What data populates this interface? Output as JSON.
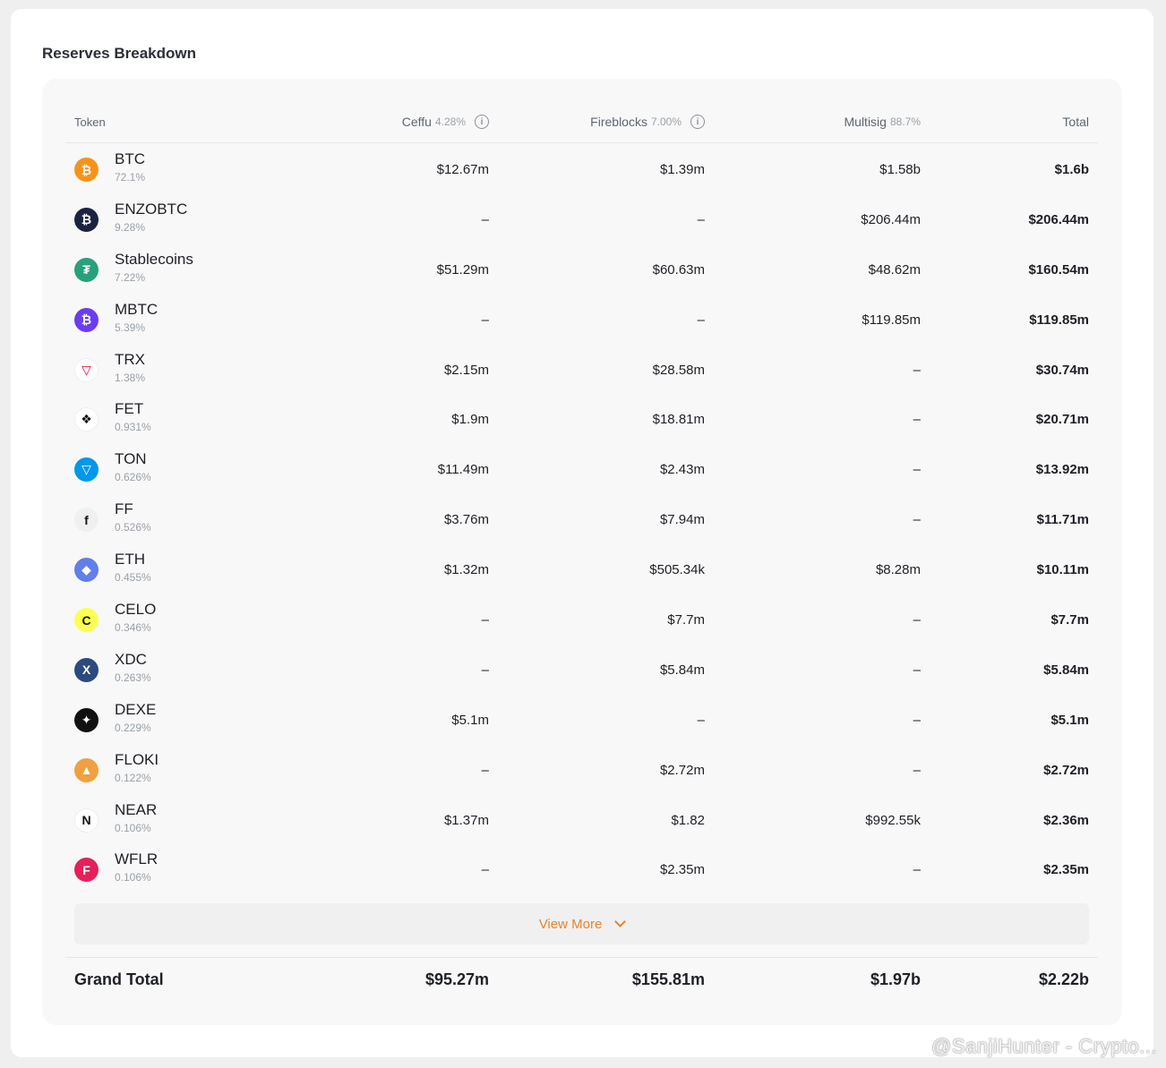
{
  "section_title": "Reserves Breakdown",
  "header": {
    "token": "Token",
    "ceffu": {
      "label": "Ceffu",
      "pct": "4.28%"
    },
    "fireblocks": {
      "label": "Fireblocks",
      "pct": "7.00%"
    },
    "multisig": {
      "label": "Multisig",
      "pct": "88.7%"
    },
    "total": "Total"
  },
  "rows": [
    {
      "name": "BTC",
      "pct": "72.1%",
      "ceffu": "$12.67m",
      "fireblocks": "$1.39m",
      "multisig": "$1.58b",
      "total": "$1.6b",
      "icon": "bitcoin-icon",
      "color": "#f7931a",
      "glyph": "₿"
    },
    {
      "name": "ENZOBTC",
      "pct": "9.28%",
      "ceffu": "–",
      "fireblocks": "–",
      "multisig": "$206.44m",
      "total": "$206.44m",
      "icon": "enzobtc-icon",
      "color": "#1a2340",
      "glyph": "₿"
    },
    {
      "name": "Stablecoins",
      "pct": "7.22%",
      "ceffu": "$51.29m",
      "fireblocks": "$60.63m",
      "multisig": "$48.62m",
      "total": "$160.54m",
      "icon": "tether-icon",
      "color": "#26a17b",
      "glyph": "₮"
    },
    {
      "name": "MBTC",
      "pct": "5.39%",
      "ceffu": "–",
      "fireblocks": "–",
      "multisig": "$119.85m",
      "total": "$119.85m",
      "icon": "mbtc-icon",
      "color": "#6a3df0",
      "glyph": "₿"
    },
    {
      "name": "TRX",
      "pct": "1.38%",
      "ceffu": "$2.15m",
      "fireblocks": "$28.58m",
      "multisig": "–",
      "total": "$30.74m",
      "icon": "tron-icon",
      "color": "#ffffff",
      "glyph": "▽"
    },
    {
      "name": "FET",
      "pct": "0.931%",
      "ceffu": "$1.9m",
      "fireblocks": "$18.81m",
      "multisig": "–",
      "total": "$20.71m",
      "icon": "fetch-icon",
      "color": "#ffffff",
      "glyph": "❖"
    },
    {
      "name": "TON",
      "pct": "0.626%",
      "ceffu": "$11.49m",
      "fireblocks": "$2.43m",
      "multisig": "–",
      "total": "$13.92m",
      "icon": "ton-icon",
      "color": "#0098ea",
      "glyph": "▽"
    },
    {
      "name": "FF",
      "pct": "0.526%",
      "ceffu": "$3.76m",
      "fireblocks": "$7.94m",
      "multisig": "–",
      "total": "$11.71m",
      "icon": "ff-icon",
      "color": "#f0f0f0",
      "glyph": "f"
    },
    {
      "name": "ETH",
      "pct": "0.455%",
      "ceffu": "$1.32m",
      "fireblocks": "$505.34k",
      "multisig": "$8.28m",
      "total": "$10.11m",
      "icon": "ethereum-icon",
      "color": "#627eea",
      "glyph": "◆"
    },
    {
      "name": "CELO",
      "pct": "0.346%",
      "ceffu": "–",
      "fireblocks": "$7.7m",
      "multisig": "–",
      "total": "$7.7m",
      "icon": "celo-icon",
      "color": "#fcff52",
      "glyph": "C"
    },
    {
      "name": "XDC",
      "pct": "0.263%",
      "ceffu": "–",
      "fireblocks": "$5.84m",
      "multisig": "–",
      "total": "$5.84m",
      "icon": "xdc-icon",
      "color": "#2a4a80",
      "glyph": "X"
    },
    {
      "name": "DEXE",
      "pct": "0.229%",
      "ceffu": "$5.1m",
      "fireblocks": "–",
      "multisig": "–",
      "total": "$5.1m",
      "icon": "dexe-icon",
      "color": "#111111",
      "glyph": "✦"
    },
    {
      "name": "FLOKI",
      "pct": "0.122%",
      "ceffu": "–",
      "fireblocks": "$2.72m",
      "multisig": "–",
      "total": "$2.72m",
      "icon": "floki-icon",
      "color": "#f0a040",
      "glyph": "▲"
    },
    {
      "name": "NEAR",
      "pct": "0.106%",
      "ceffu": "$1.37m",
      "fireblocks": "$1.82",
      "multisig": "$992.55k",
      "total": "$2.36m",
      "icon": "near-icon",
      "color": "#ffffff",
      "glyph": "N"
    },
    {
      "name": "WFLR",
      "pct": "0.106%",
      "ceffu": "–",
      "fireblocks": "$2.35m",
      "multisig": "–",
      "total": "$2.35m",
      "icon": "flare-icon",
      "color": "#e62058",
      "glyph": "F"
    }
  ],
  "view_more": "View More",
  "grand_total": {
    "label": "Grand Total",
    "ceffu": "$95.27m",
    "fireblocks": "$155.81m",
    "multisig": "$1.97b",
    "total": "$2.22b"
  },
  "watermark": "@SanjiHunter - Crypto..."
}
